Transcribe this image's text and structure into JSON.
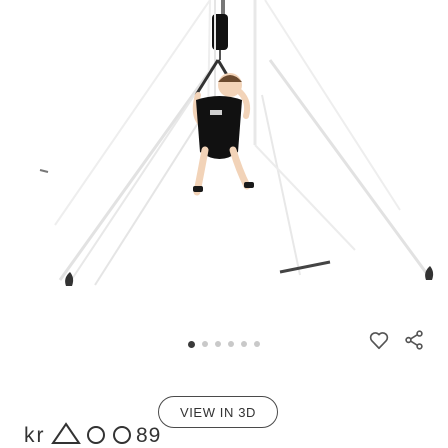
{
  "product": {
    "image_description_icon": "baby-jumper-doorway-photo"
  },
  "carousel": {
    "total": 6,
    "active_index": 0
  },
  "actions": {
    "favorite_icon": "heart-outline-icon",
    "share_icon": "share-icon"
  },
  "view3d": {
    "label": "VIEW IN 3D"
  },
  "brand": {
    "logo_text": "kr△O O89"
  },
  "colors": {
    "accent": "#3a3a3a",
    "dot_inactive": "#c9c9c9",
    "frame": "#e0e0e0",
    "seat_black": "#111111"
  }
}
